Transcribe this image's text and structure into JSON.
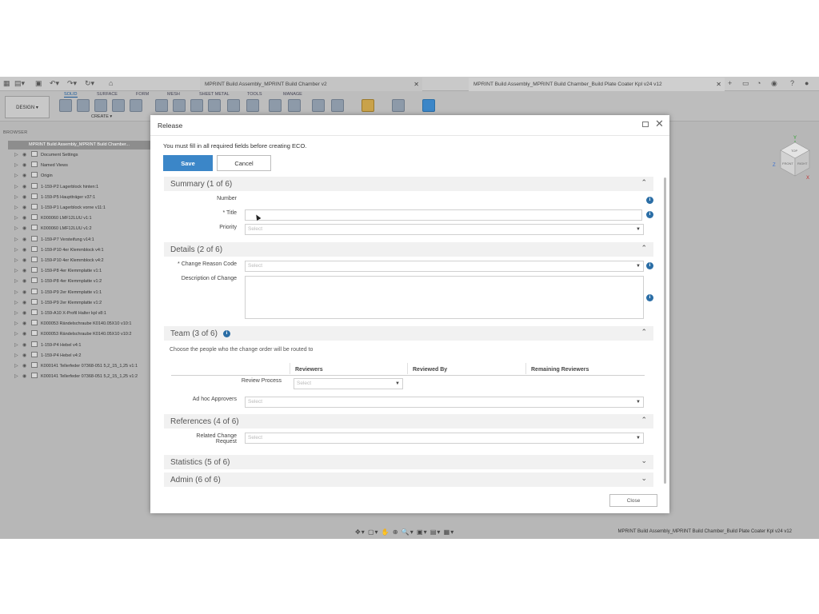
{
  "doc_tabs": [
    {
      "title": "MPRINT Build Assembly_MPRINT Build Chamber v2"
    },
    {
      "title": "MPRINT Build Assembly_MPRINT Build Chamber_Build Plate Coater Kpl v24 v12"
    }
  ],
  "ribbon": {
    "design_label": "DESIGN ▾",
    "tabs": [
      "SOLID",
      "SURFACE",
      "FORM",
      "MESH",
      "SHEET METAL",
      "TOOLS",
      "MANAGE"
    ],
    "create_label": "CREATE ▾"
  },
  "browser": {
    "header": "BROWSER",
    "root": "MPRINT Build Assembly_MPRINT Build Chamber...",
    "items": [
      "Document Settings",
      "Named Views",
      "Origin",
      "1-159-P2 Lagerblock hinten:1",
      "1-159-P5 Hauptträger v37:1",
      "1-159-P1 Lagerblock vorne v11:1",
      "K000060 LMF12LUU v1:1",
      "K000060 LMF12LUU v1:2",
      "1-159-P7 Versteifung v14:1",
      "1-159-P10 4er Klemmblock v4:1",
      "1-159-P10 4er Klemmblock v4:2",
      "1-159-P8 4er Klemmplatte v1:1",
      "1-159-P8 4er Klemmplatte v1:2",
      "1-159-P9 2er Klemmplatte v1:1",
      "1-159-P9 2er Klemmplatte v1:2",
      "1-159-A10 X-Profil Halter kpl v8:1",
      "K000053 Rändelschraube K0140.05X10 v10:1",
      "K000053 Rändelschraube K0140.05X10 v10:2",
      "1-159-P4 Hebel v4:1",
      "1-159-P4 Hebel v4:2",
      "K000141 Tellerfeder 07368-051 5,2_15_1,25 v1:1",
      "K000141 Tellerfeder 07368-051 5,2_15_1,25 v1:2"
    ]
  },
  "viewcube": {
    "x": "X",
    "y": "Y",
    "z": "Z",
    "face_top": "TOP",
    "face_front": "FRONT",
    "face_right": "RIGHT"
  },
  "status": {
    "document_title": "MPRINT Build Assembly_MPRINT Build Chamber_Build Plate Coater Kpl v24 v12"
  },
  "dialog": {
    "title": "Release",
    "message": "You must fill in all required fields before creating ECO.",
    "save_label": "Save",
    "cancel_label": "Cancel",
    "close_label": "Close",
    "sections": {
      "summary": {
        "title": "Summary (1 of 6)",
        "number_label": "Number",
        "title_label": "* Title",
        "priority_label": "Priority",
        "priority_placeholder": "Select"
      },
      "details": {
        "title": "Details (2 of 6)",
        "change_reason_label": "* Change Reason Code",
        "change_reason_placeholder": "Select",
        "description_label": "Description of Change"
      },
      "team": {
        "title": "Team (3 of 6)",
        "subtitle": "Choose the people who the change order will be routed to",
        "col_reviewers": "Reviewers",
        "col_reviewed_by": "Reviewed By",
        "col_remaining": "Remaining Reviewers",
        "review_process_label": "Review Process",
        "review_process_placeholder": "Select",
        "adhoc_label": "Ad hoc Approvers",
        "adhoc_placeholder": "Select"
      },
      "references": {
        "title": "References (4 of 6)",
        "related_label_line1": "Related Change",
        "related_label_line2": "Request",
        "related_placeholder": "Select"
      },
      "statistics": {
        "title": "Statistics (5 of 6)"
      },
      "admin": {
        "title": "Admin (6 of 6)"
      }
    }
  }
}
